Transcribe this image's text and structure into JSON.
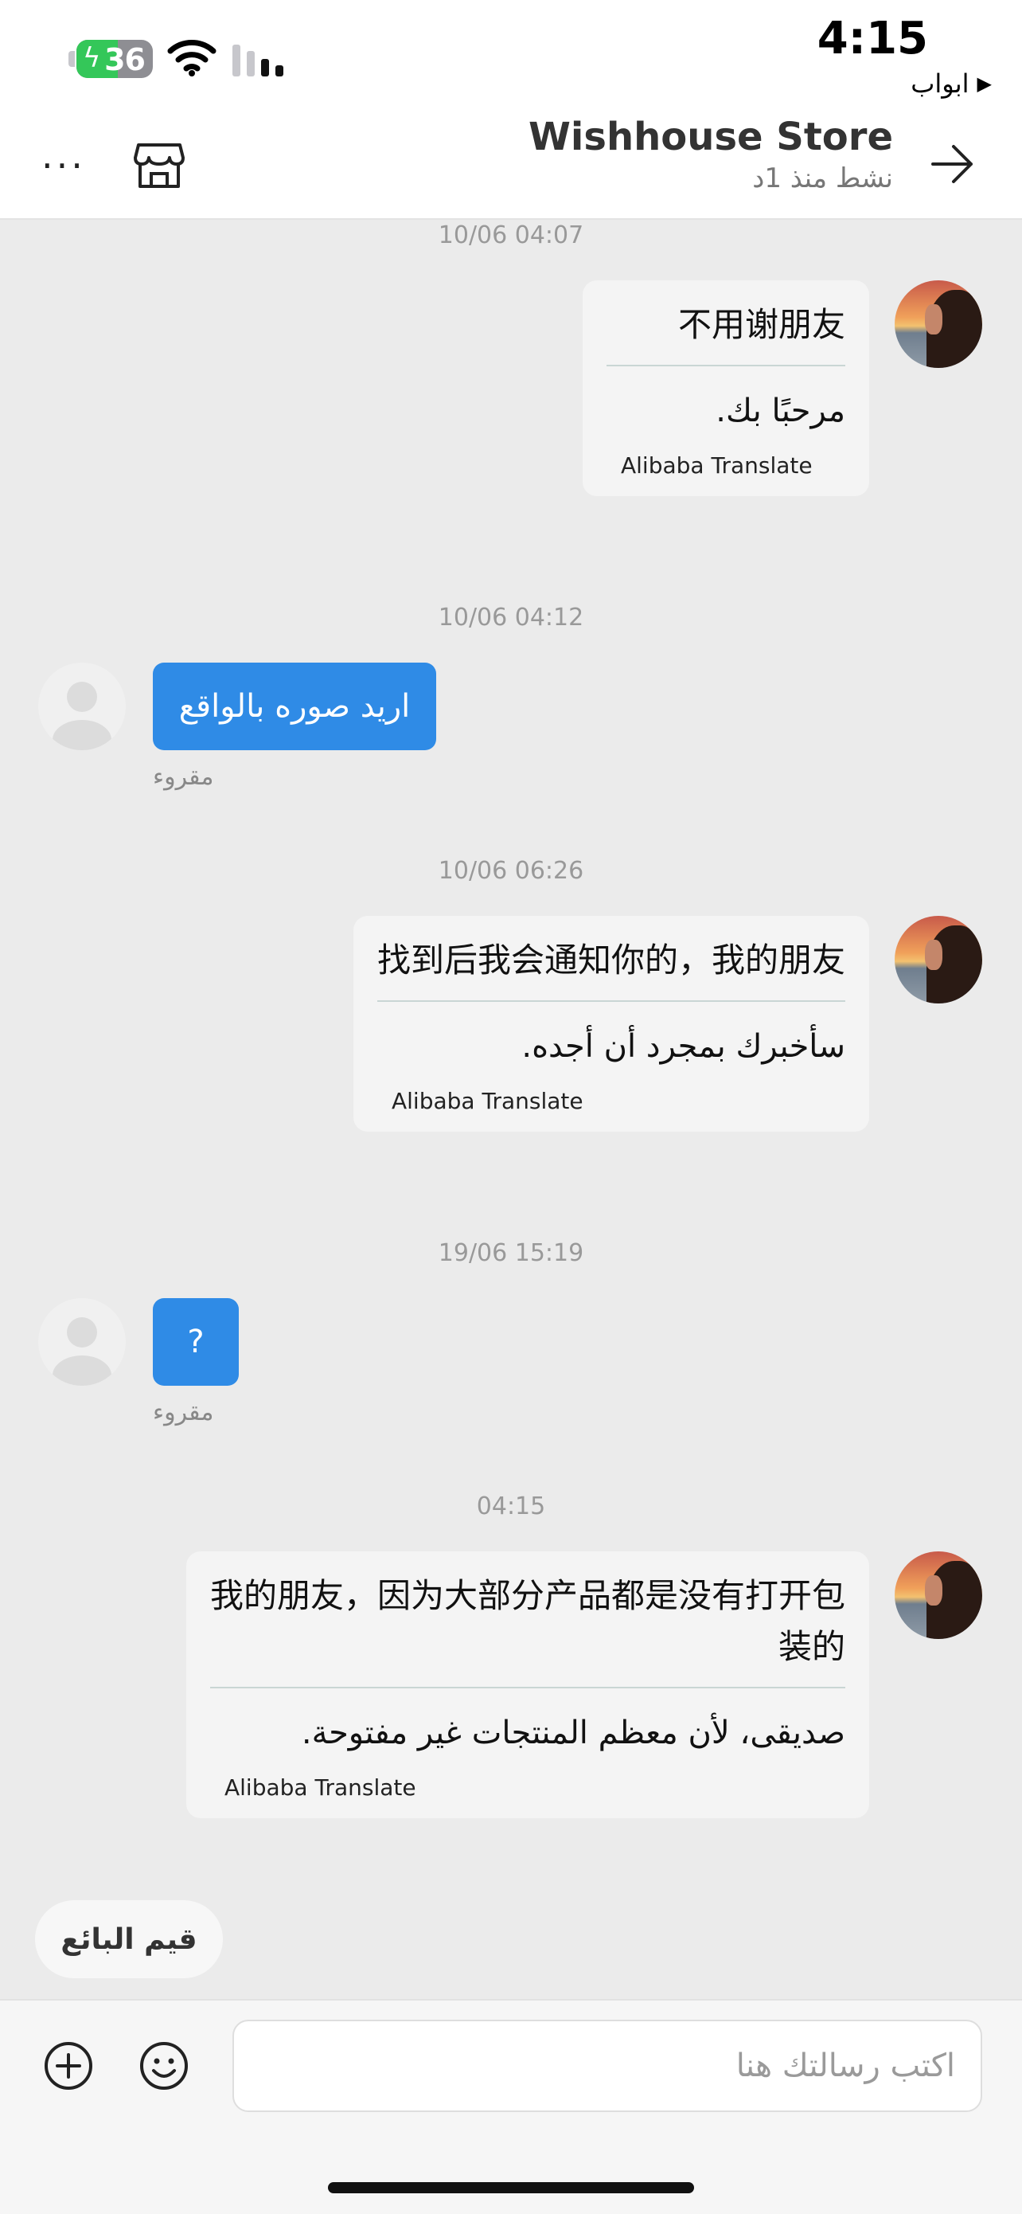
{
  "status_bar": {
    "time": "4:15",
    "battery_level": "36",
    "back_app_label": "ابواب",
    "back_app_icon": "play-triangle-icon"
  },
  "header": {
    "store_name": "Wishhouse Store",
    "active_status": "نشط منذ 1د",
    "back_icon": "arrow-right-icon",
    "store_icon": "store-icon",
    "more_icon": "more-horizontal-icon"
  },
  "messages": [
    {
      "timestamp": "10/06 04:07",
      "sender": "seller",
      "original": "不用谢朋友",
      "translation": "مرحبًا بك.",
      "credit": "Alibaba Translate"
    },
    {
      "timestamp": "10/06 04:12",
      "sender": "user",
      "text": "اريد صوره بالواقع",
      "status": "مقروء"
    },
    {
      "timestamp": "10/06 06:26",
      "sender": "seller",
      "original": "找到后我会通知你的，我的朋友",
      "translation": "سأخبرك بمجرد أن أجده.",
      "credit": "Alibaba Translate"
    },
    {
      "timestamp": "19/06 15:19",
      "sender": "user",
      "text": "?",
      "status": "مقروء"
    },
    {
      "timestamp": "04:15",
      "sender": "seller",
      "original": "我的朋友，因为大部分产品都是没有打开包装的",
      "translation": "صديقى، لأن معظم المنتجات غير مفتوحة.",
      "credit": "Alibaba Translate"
    }
  ],
  "rate_seller_label": "قيم البائع",
  "composer": {
    "placeholder": "اكتب رسالتك هنا",
    "plus_icon": "plus-circle-icon",
    "emoji_icon": "emoji-icon"
  },
  "colors": {
    "user_bubble": "#2f8be6",
    "seller_bubble": "#f4f4f4",
    "chat_background": "#ebebeb",
    "battery_green": "#34c759"
  }
}
